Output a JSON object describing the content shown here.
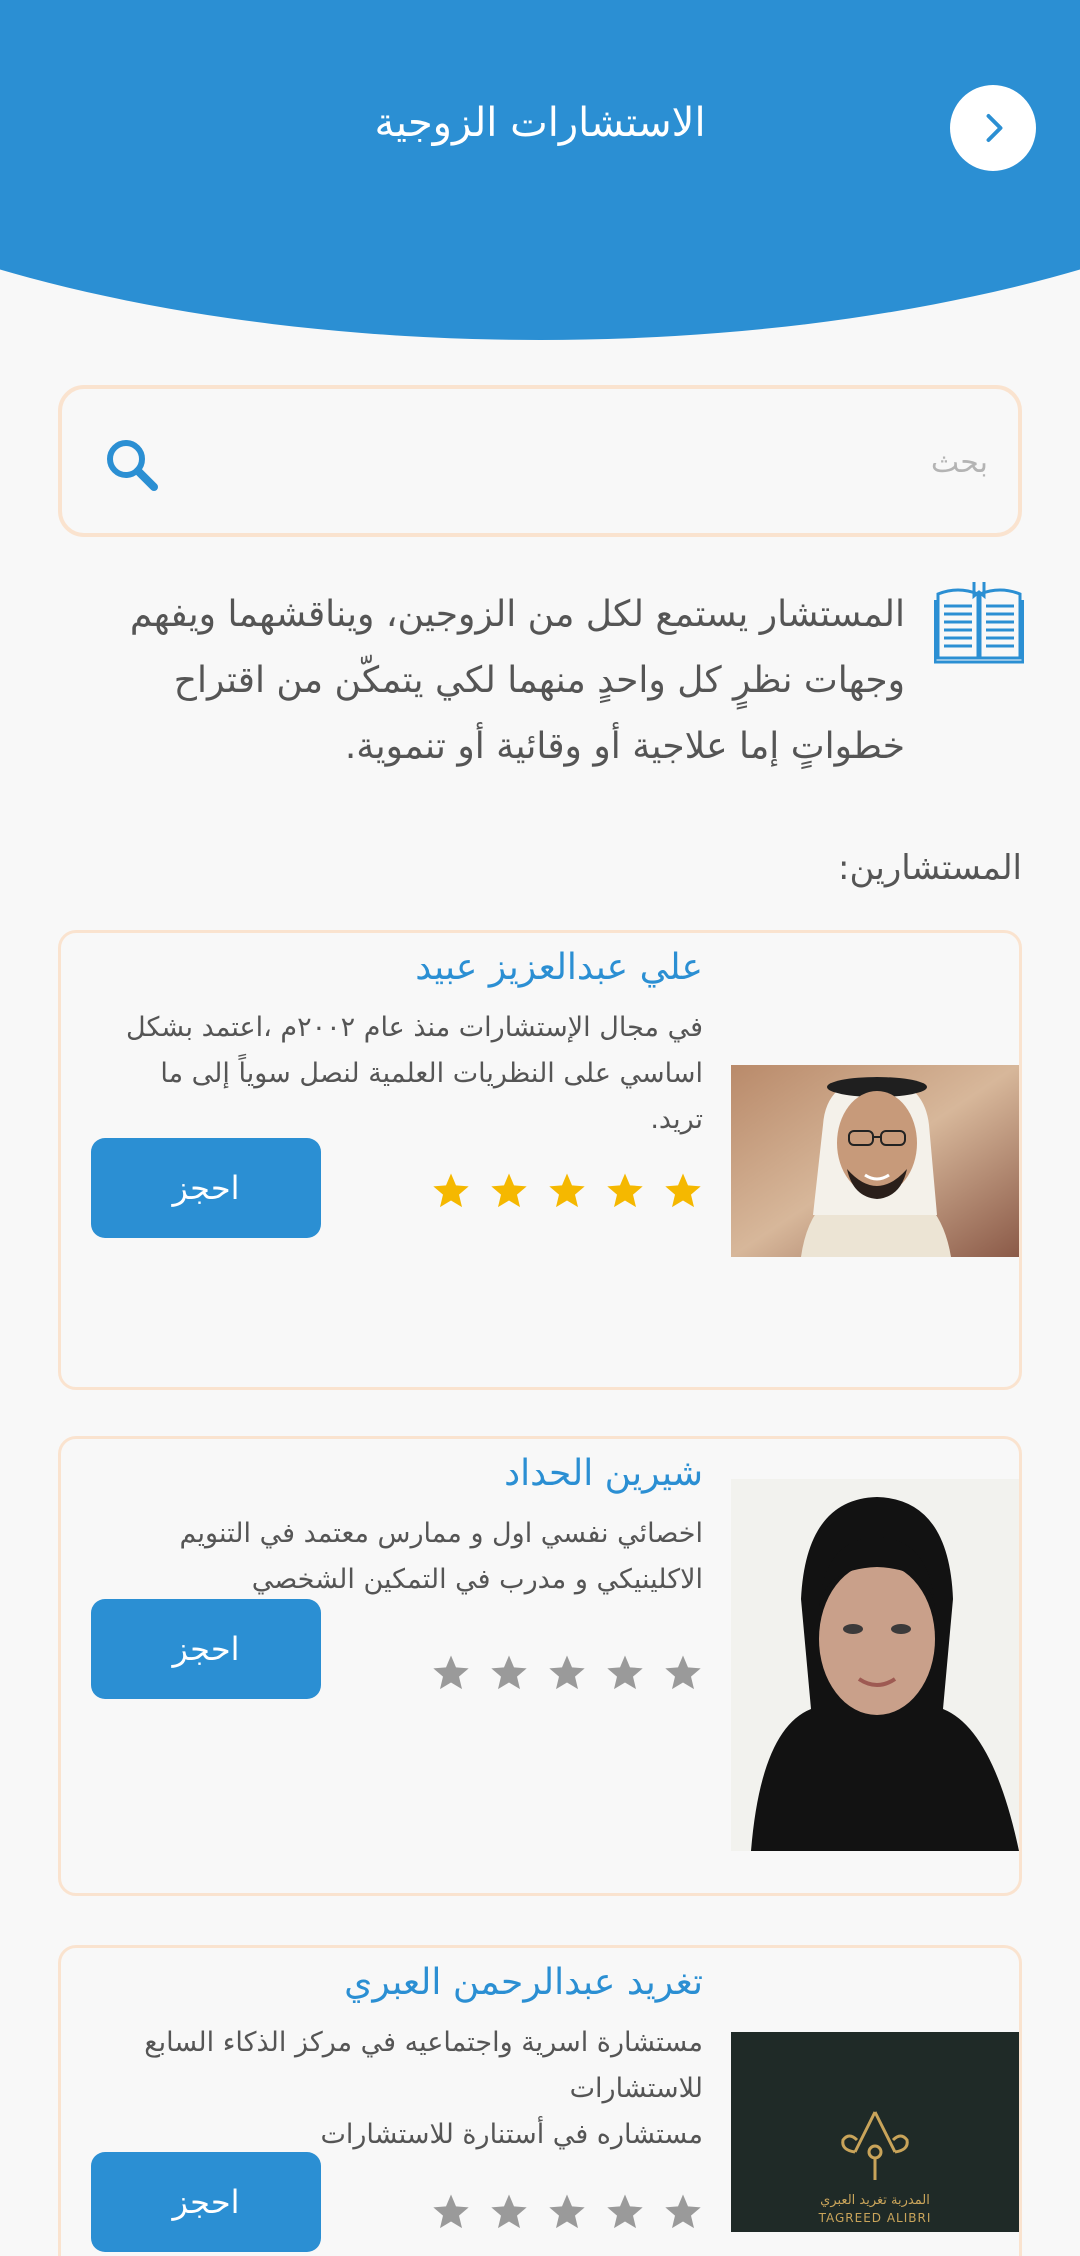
{
  "header": {
    "title": "الاستشارات  الزوجية"
  },
  "search": {
    "placeholder": "بحث"
  },
  "intro": {
    "text": "المستشار يستمع لكل من الزوجين، ويناقشهما ويفهم وجهات نظرٍ كل واحدٍ منهما لكي يتمكّن من اقتراح خطواتٍ إما علاجية أو وقائية أو تنموية."
  },
  "section_label": "المستشارين:",
  "consultants": [
    {
      "name": "علي عبدالعزيز عبيد",
      "description": "في مجال الإستشارات منذ عام ٢٠٠٢م ،اعتمد بشكل اساسي على النظريات العلمية لنصل سوياً إلى ما تريد.",
      "rating": 5,
      "book_label": "احجز"
    },
    {
      "name": "شيرين الحداد",
      "description": "اخصائي نفسي اول  و ممارس معتمد في التنويم الاكلينيكي و مدرب في التمكين الشخصي",
      "rating": 0,
      "book_label": "احجز"
    },
    {
      "name": "تغريد عبدالرحمن العبري",
      "description_line1": "مستشارة اسرية واجتماعيه في مركز الذكاء السابع للاستشارات",
      "description_line2": "مستشاره في أستنارة للاستشارات",
      "rating": 0,
      "book_label": "احجز",
      "logo_text_ar": "المدربة تغريد العبري",
      "logo_text_en": "TAGREED ALIBRI"
    }
  ],
  "colors": {
    "primary": "#2b8fd3",
    "card_border": "#fae3cf",
    "star_filled": "#f5b800",
    "star_empty": "#9a9a9a",
    "background": "#f8f8f8"
  }
}
